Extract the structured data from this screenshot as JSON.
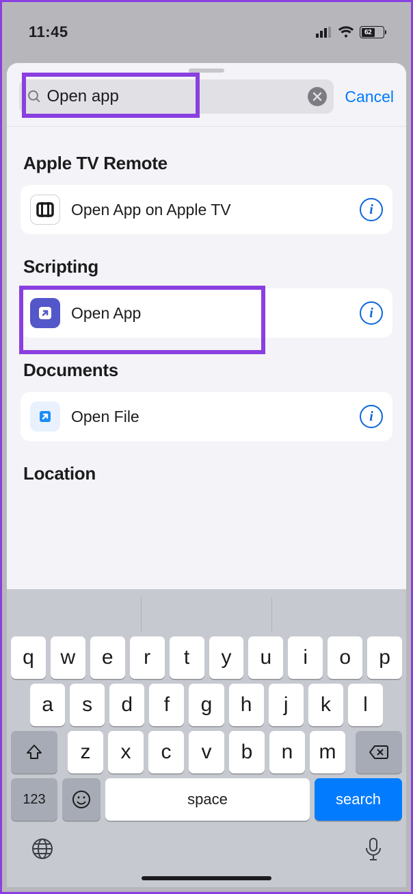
{
  "status": {
    "time": "11:45",
    "battery": "62",
    "battery_pct": 62
  },
  "search": {
    "value": "Open app",
    "cancel": "Cancel"
  },
  "sections": [
    {
      "title": "Apple TV Remote",
      "item": "Open App on Apple TV",
      "icon": "appletv"
    },
    {
      "title": "Scripting",
      "item": "Open App",
      "icon": "openapp",
      "highlighted": true
    },
    {
      "title": "Documents",
      "item": "Open File",
      "icon": "openfile"
    },
    {
      "title": "Location",
      "item": "",
      "icon": ""
    }
  ],
  "keyboard": {
    "row1": [
      "q",
      "w",
      "e",
      "r",
      "t",
      "y",
      "u",
      "i",
      "o",
      "p"
    ],
    "row2": [
      "a",
      "s",
      "d",
      "f",
      "g",
      "h",
      "j",
      "k",
      "l"
    ],
    "row3": [
      "z",
      "x",
      "c",
      "v",
      "b",
      "n",
      "m"
    ],
    "num": "123",
    "space": "space",
    "search": "search"
  }
}
